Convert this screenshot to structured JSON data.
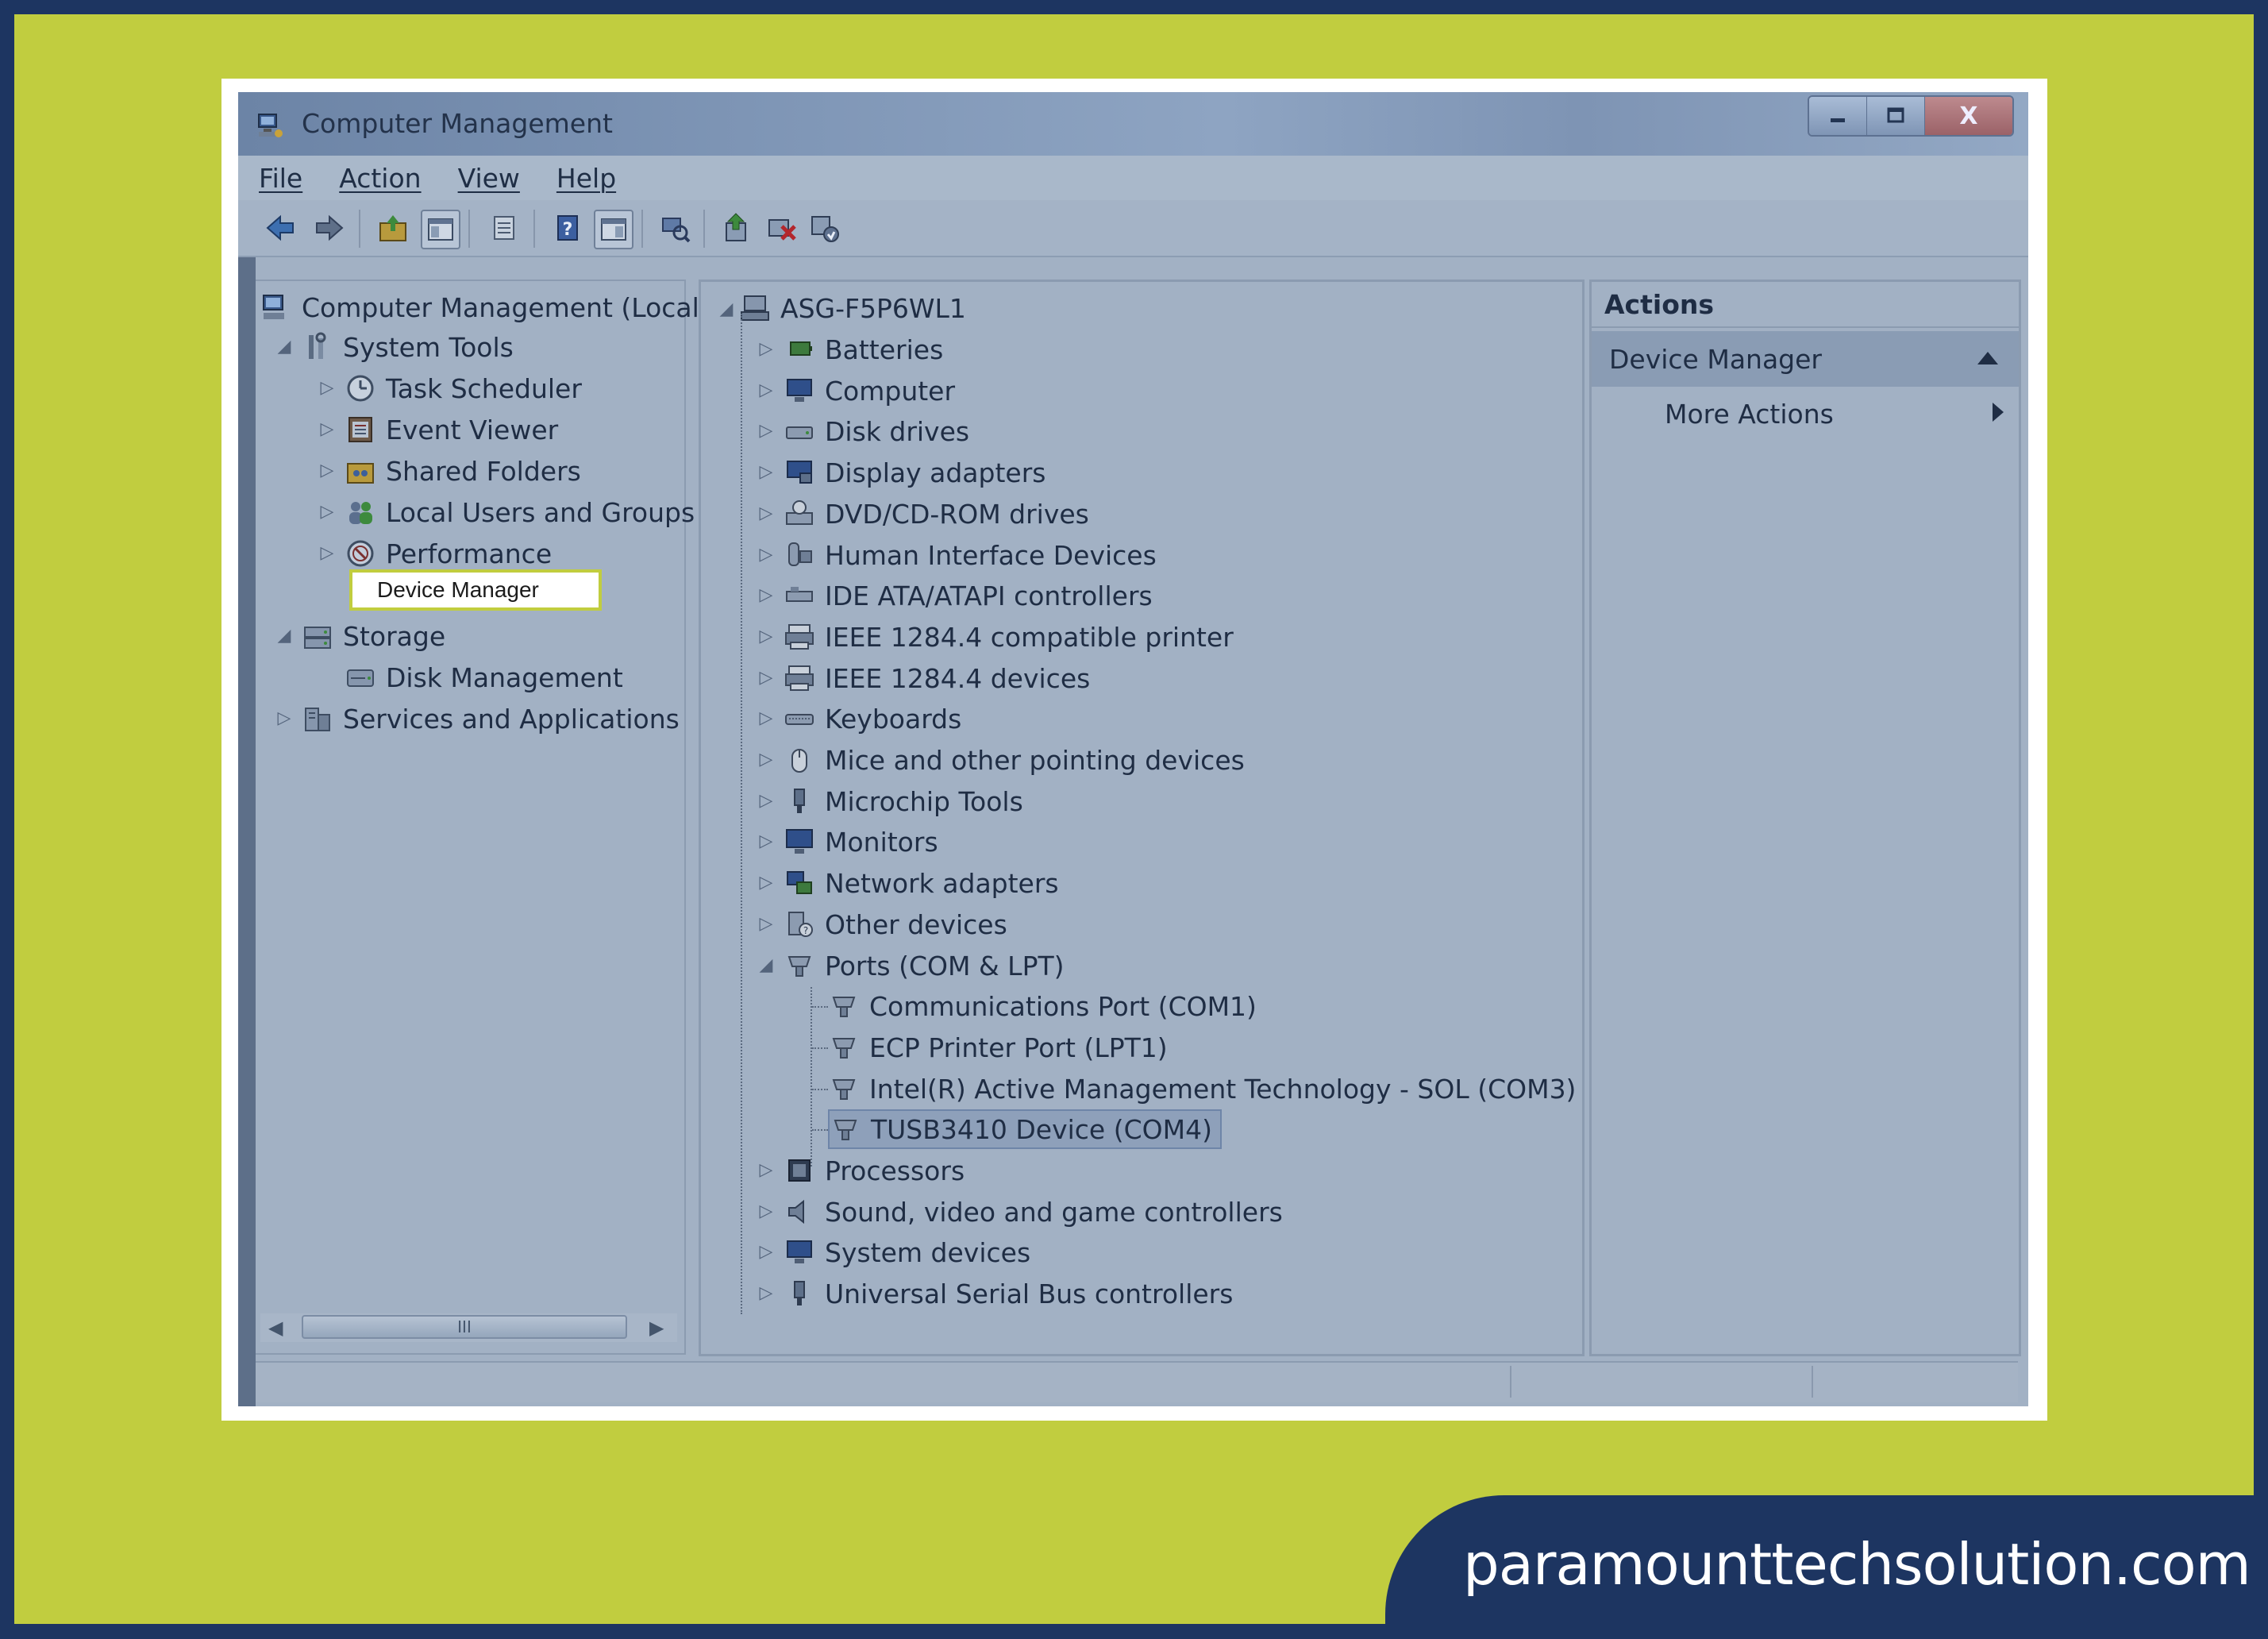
{
  "window": {
    "title": "Computer Management",
    "buttons": {
      "minimize": "–",
      "maximize": "□",
      "close": "X"
    }
  },
  "menu": [
    "File",
    "Action",
    "View",
    "Help"
  ],
  "toolbar_icons": [
    "back-arrow-icon",
    "forward-arrow-icon",
    "up-folder-icon",
    "show-hide-console-tree-icon",
    "properties-icon",
    "help-icon",
    "show-hide-action-pane-icon",
    "scan-hardware-icon",
    "update-driver-icon",
    "uninstall-device-icon",
    "disable-device-icon"
  ],
  "left_tree": {
    "root": "Computer Management (Local",
    "system_tools": "System Tools",
    "task_scheduler": "Task Scheduler",
    "event_viewer": "Event Viewer",
    "shared_folders": "Shared Folders",
    "local_users": "Local Users and Groups",
    "performance": "Performance",
    "device_manager": "Device Manager",
    "storage": "Storage",
    "disk_management": "Disk Management",
    "services": "Services and Applications",
    "scroll_thumb": "III"
  },
  "device_tree": {
    "computer_name": "ASG-F5P6WL1",
    "categories": [
      "Batteries",
      "Computer",
      "Disk drives",
      "Display adapters",
      "DVD/CD-ROM drives",
      "Human Interface Devices",
      "IDE ATA/ATAPI controllers",
      "IEEE 1284.4 compatible printer",
      "IEEE 1284.4 devices",
      "Keyboards",
      "Mice and other pointing devices",
      "Microchip Tools",
      "Monitors",
      "Network adapters",
      "Other devices",
      "Ports (COM & LPT)"
    ],
    "ports": [
      "Communications Port (COM1)",
      "ECP Printer Port (LPT1)",
      "Intel(R) Active Management Technology - SOL (COM3)",
      "TUSB3410 Device (COM4)"
    ],
    "categories_after": [
      "Processors",
      "Sound, video and game controllers",
      "System devices",
      "Universal Serial Bus controllers"
    ]
  },
  "actions": {
    "header": "Actions",
    "section": "Device Manager",
    "more": "More Actions"
  },
  "brand": "paramounttechsolution.com",
  "colors": {
    "frame": "#1d3561",
    "accent": "#c1cd3f",
    "window_overlay": "#a2b1c4"
  }
}
